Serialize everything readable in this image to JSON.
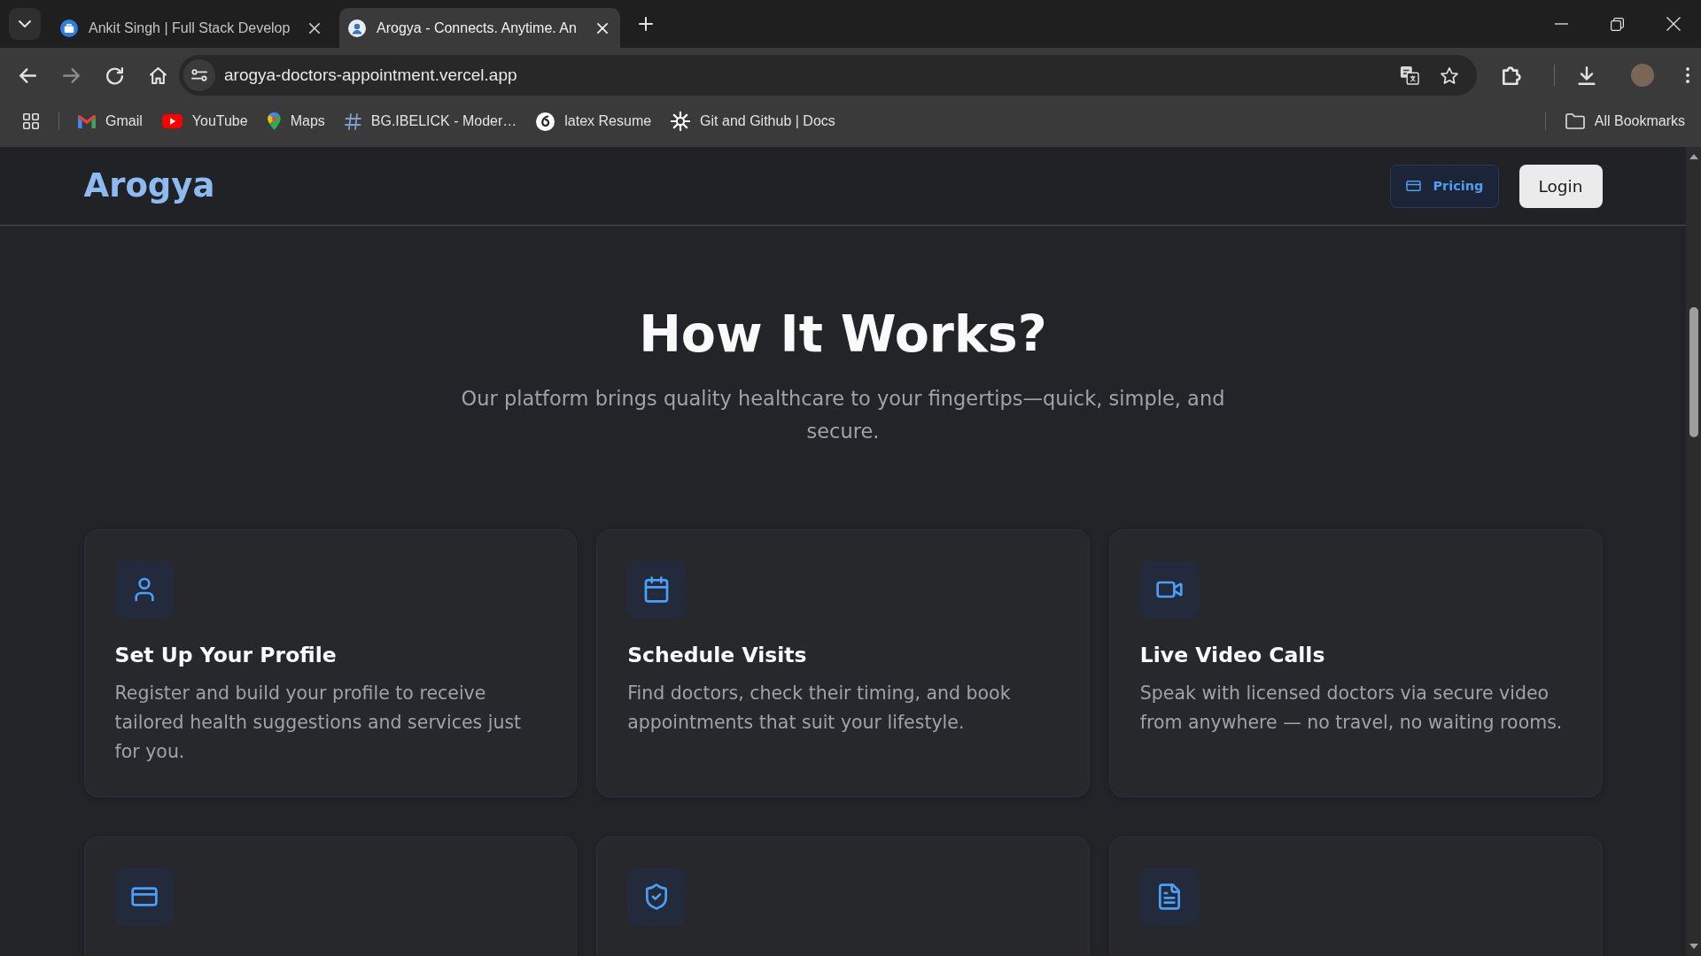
{
  "browser": {
    "tabs": [
      {
        "kind": "briefcase",
        "title": "Ankit Singh | Full Stack Develop",
        "selected": false
      },
      {
        "kind": "logo",
        "title": "Arogya - Connects. Anytime. An",
        "selected": true
      }
    ],
    "address": "arogya-doctors-appointment.vercel.app",
    "bookmarks": [
      {
        "kind": "mail",
        "label": "Gmail"
      },
      {
        "kind": "play",
        "label": "YouTube"
      },
      {
        "kind": "pin",
        "label": "Maps"
      },
      {
        "kind": "hash",
        "label": "BG.IBELICK - Moder…"
      },
      {
        "kind": "swirl",
        "label": "latex Resume"
      },
      {
        "kind": "gear",
        "label": "Git and Github | Docs"
      }
    ],
    "all_bookmarks": "All Bookmarks"
  },
  "header": {
    "brand": "Arogya",
    "pricing": "Pricing",
    "login": "Login"
  },
  "hero": {
    "title": "How It Works?",
    "subtitle": "Our platform brings quality healthcare to your fingertips—quick, simple, and secure."
  },
  "features": [
    {
      "kind": "user",
      "title": "Set Up Your Profile",
      "text": "Register and build your profile to receive tailored health suggestions and services just for you."
    },
    {
      "kind": "calendar",
      "title": "Schedule Visits",
      "text": "Find doctors, check their timing, and book appointments that suit your lifestyle."
    },
    {
      "kind": "video",
      "title": "Live Video Calls",
      "text": "Speak with licensed doctors via secure video from anywhere — no travel, no waiting rooms."
    },
    {
      "kind": "card"
    },
    {
      "kind": "shield"
    },
    {
      "kind": "document"
    }
  ]
}
